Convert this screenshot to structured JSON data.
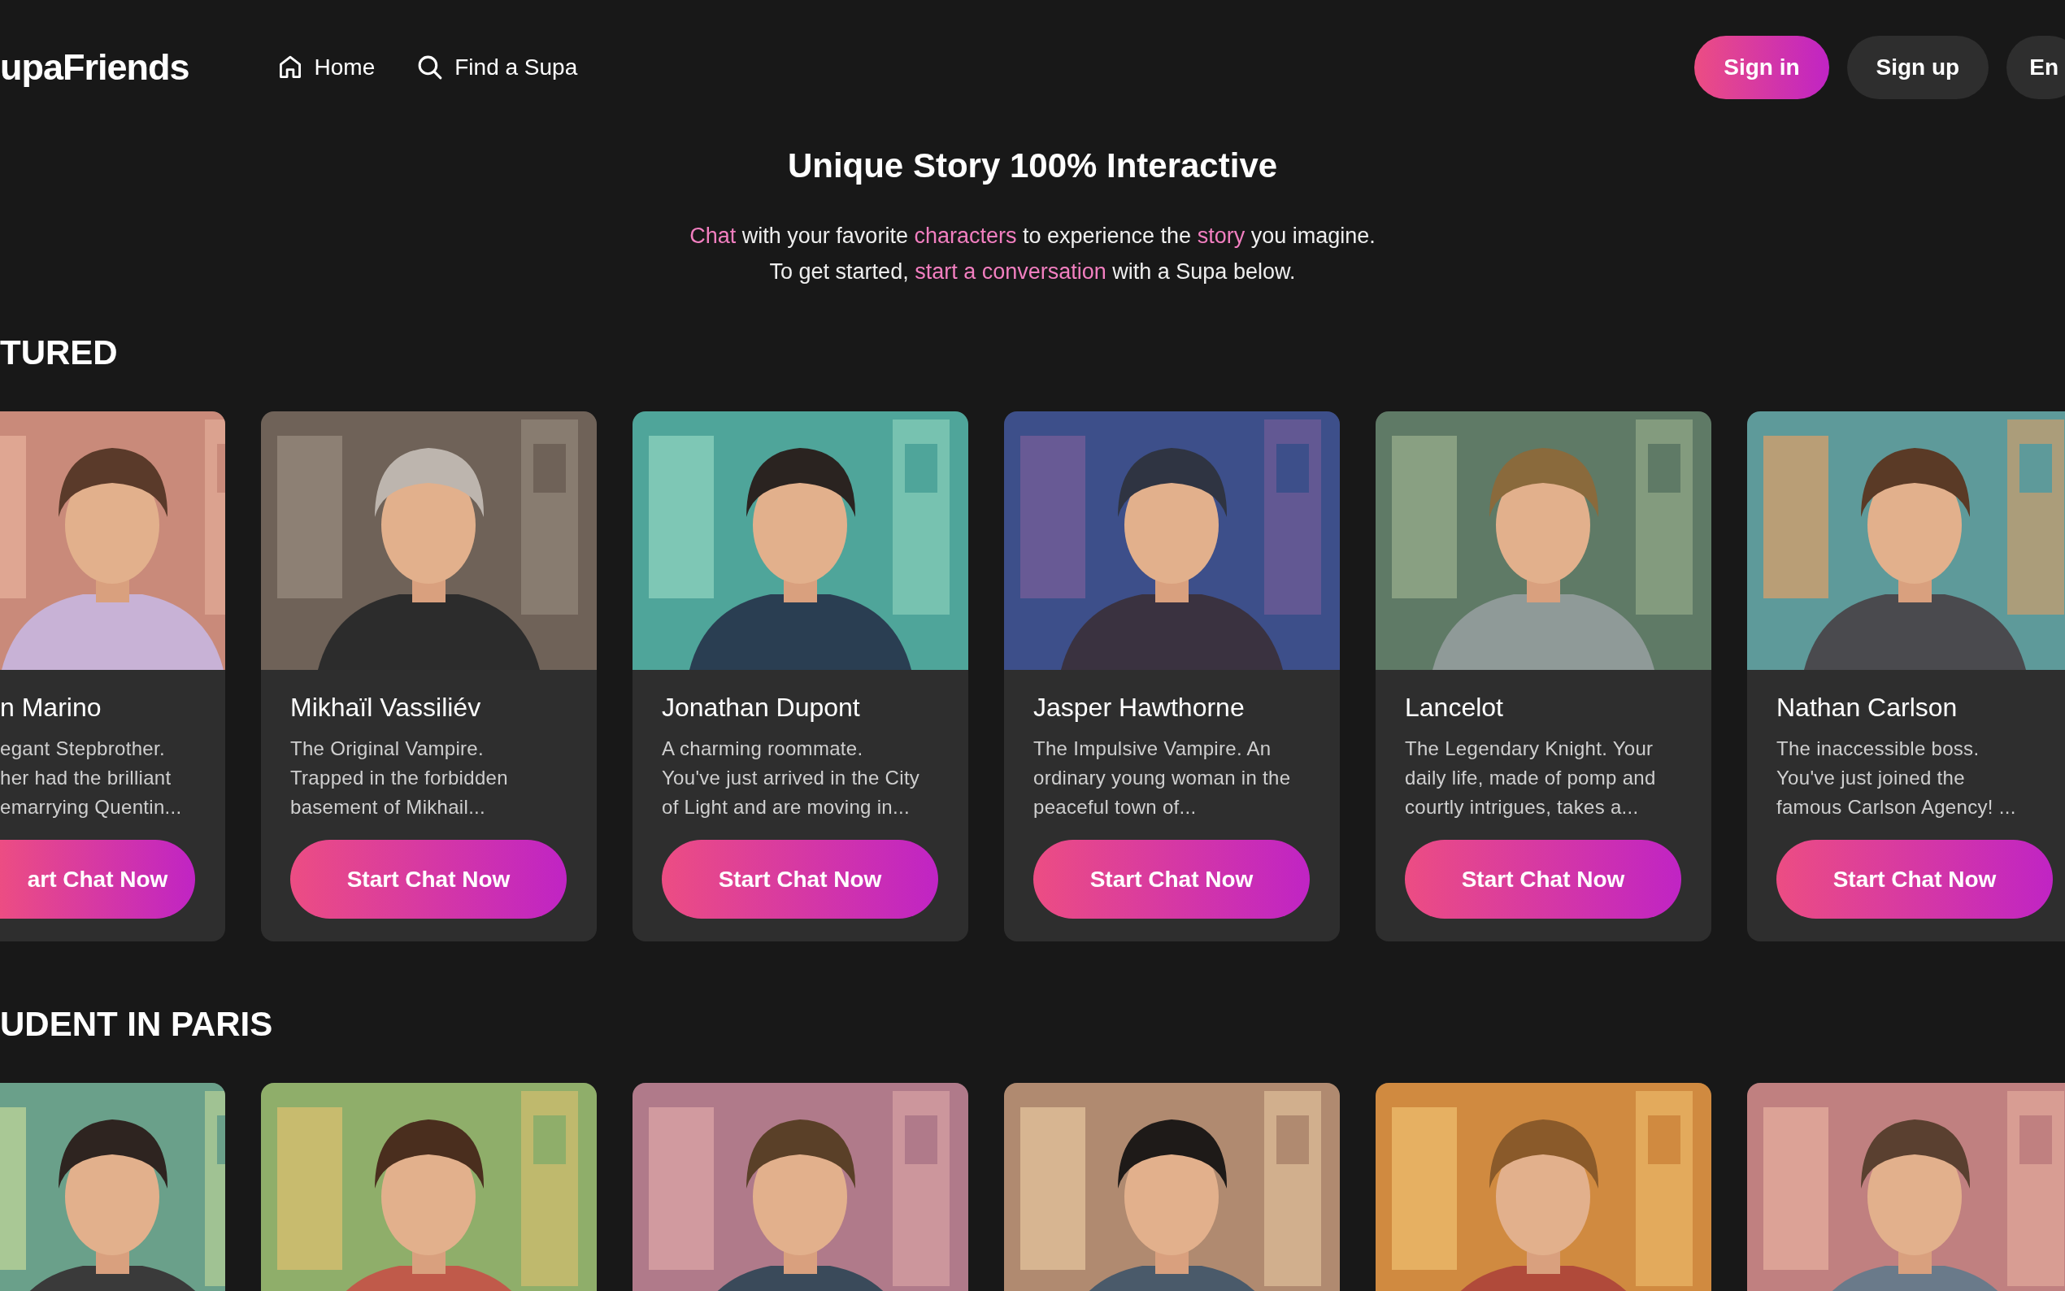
{
  "header": {
    "logo": "upaFriends",
    "nav": [
      {
        "label": "Home"
      },
      {
        "label": "Find a Supa"
      }
    ],
    "buttons": [
      {
        "label": "Sign in",
        "kind": "primary"
      },
      {
        "label": "Sign up",
        "kind": "secondary"
      },
      {
        "label": "En",
        "kind": "secondary"
      }
    ]
  },
  "hero": {
    "title": "Unique Story 100% Interactive",
    "lines": [
      [
        {
          "text": "Chat",
          "highlight": true
        },
        {
          "text": " with your favorite ",
          "highlight": false
        },
        {
          "text": "characters",
          "highlight": true
        },
        {
          "text": " to experience the ",
          "highlight": false
        },
        {
          "text": "story",
          "highlight": true
        },
        {
          "text": " you imagine.",
          "highlight": false
        }
      ],
      [
        {
          "text": "To get started, ",
          "highlight": false
        },
        {
          "text": "start a conversation",
          "highlight": true
        },
        {
          "text": " with a Supa below.",
          "highlight": false
        }
      ]
    ]
  },
  "sections": [
    {
      "title": "TURED",
      "cards": [
        {
          "name": "n Marino",
          "description": "egant Stepbrother.\nher had the brilliant\nemarrying Quentin...",
          "button": "art Chat Now"
        },
        {
          "name": "Mikhaïl Vassiliév",
          "description": "The Original Vampire.\nTrapped in the forbidden\nbasement of Mikhail...",
          "button": "Start Chat Now"
        },
        {
          "name": "Jonathan Dupont",
          "description": "A charming roommate.\nYou've just arrived in the City\nof Light and are moving in...",
          "button": "Start Chat Now"
        },
        {
          "name": "Jasper Hawthorne",
          "description": "The Impulsive Vampire. An\nordinary young woman in the\npeaceful town of...",
          "button": "Start Chat Now"
        },
        {
          "name": "Lancelot",
          "description": "The Legendary Knight. Your\ndaily life, made of pomp and\ncourtly intrigues, takes a...",
          "button": "Start Chat Now"
        },
        {
          "name": "Nathan Carlson",
          "description": "The inaccessible boss.\nYou've just joined the\nfamous Carlson Agency! ...",
          "button": "Start Chat Now"
        }
      ]
    },
    {
      "title": "UDENT IN PARIS"
    }
  ]
}
